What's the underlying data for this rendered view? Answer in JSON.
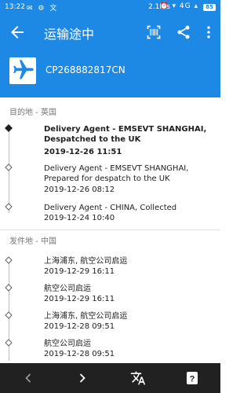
{
  "status_bar": {
    "time": "13:22",
    "left_icons": "✉ ⚙ 文",
    "speed": "2.1K/s",
    "signal": "⏰ ▾ 4G ▴",
    "battery": "85"
  },
  "app_bar": {
    "title": "运输途中"
  },
  "header": {
    "tracking_number": "CP268882817CN"
  },
  "destination": {
    "label": "目的地 - 英国",
    "events": [
      {
        "desc": "Delivery Agent - EMSEVT SHANGHAI, Despatched to the UK",
        "date": "2019-12-26 11:51"
      },
      {
        "desc": "Delivery Agent - EMSEVT SHANGHAI, Prepared for despatch to the UK",
        "date": "2019-12-26 08:12"
      },
      {
        "desc": "Delivery Agent - CHINA, Collected",
        "date": "2019-12-24 10:40"
      }
    ]
  },
  "origin": {
    "label": "发件地 - 中国",
    "events": [
      {
        "desc": "上海浦东, 航空公司启运",
        "date": "2019-12-29 16:11"
      },
      {
        "desc": "航空公司启运",
        "date": "2019-12-29 16:11"
      },
      {
        "desc": "上海浦东, 航空公司启运",
        "date": "2019-12-28 09:51"
      },
      {
        "desc": "航空公司启运",
        "date": "2019-12-28 09:51"
      }
    ]
  },
  "icons": {
    "back": "arrow-left-icon",
    "barcode": "barcode-scan-icon",
    "share": "share-icon",
    "more": "more-vert-icon",
    "plane": "airplane-icon",
    "prev": "chevron-left-icon",
    "next": "chevron-right-icon",
    "translate": "translate-icon",
    "help": "help-icon"
  },
  "colors": {
    "primary": "#1e88e5",
    "nav_bar": "#212121"
  }
}
